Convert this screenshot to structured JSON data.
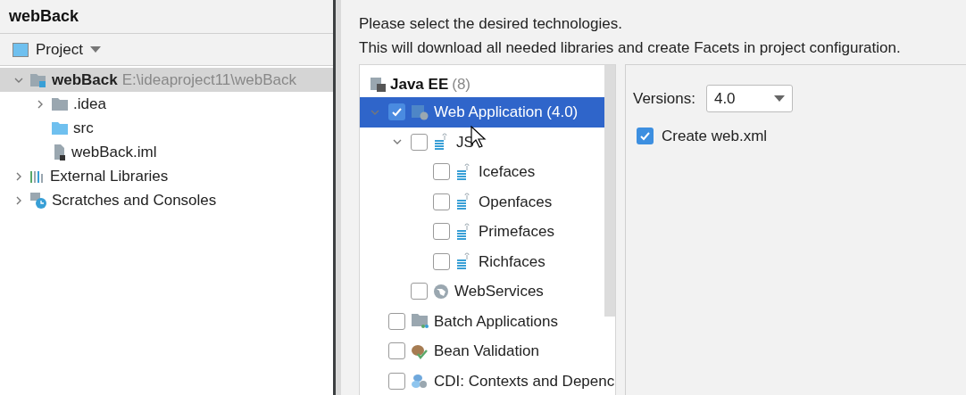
{
  "project_window": {
    "title": "webBack",
    "view_selector": "Project",
    "tree": [
      {
        "label": "webBack",
        "path": "E:\\ideaproject11\\webBack",
        "kind": "module",
        "selected": true,
        "expanded": true,
        "children": [
          {
            "label": ".idea",
            "kind": "folder",
            "expanded": false
          },
          {
            "label": "src",
            "kind": "source"
          },
          {
            "label": "webBack.iml",
            "kind": "file"
          }
        ]
      },
      {
        "label": "External Libraries",
        "kind": "libraries",
        "selected": false,
        "expanded": false
      },
      {
        "label": "Scratches and Consoles",
        "kind": "scratches",
        "selected": false,
        "expanded": false
      }
    ]
  },
  "dialog": {
    "instructions": [
      "Please select the desired technologies.",
      "This will download all needed libraries and create Facets in project configuration."
    ],
    "group": {
      "label": "Java EE",
      "count": "(8)"
    },
    "frameworks": [
      {
        "label": "Web Application (4.0)",
        "kind": "web",
        "checked": true,
        "selected": true,
        "expanded": true,
        "children": [
          {
            "label": "JS",
            "kind": "jsf",
            "checked": false,
            "selected": false,
            "expanded": true,
            "children": [
              {
                "label": "Icefaces",
                "kind": "jsf",
                "checked": false,
                "selected": false
              },
              {
                "label": "Openfaces",
                "kind": "jsf",
                "checked": false,
                "selected": false
              },
              {
                "label": "Primefaces",
                "kind": "jsf",
                "checked": false,
                "selected": false
              },
              {
                "label": "Richfaces",
                "kind": "jsf",
                "checked": false,
                "selected": false
              }
            ]
          },
          {
            "label": "WebServices",
            "kind": "globe",
            "checked": false,
            "selected": false
          }
        ]
      },
      {
        "label": "Batch Applications",
        "kind": "batch",
        "checked": false,
        "selected": false
      },
      {
        "label": "Bean Validation",
        "kind": "bean",
        "checked": false,
        "selected": false
      },
      {
        "label": "CDI: Contexts and Depenc",
        "kind": "cdi",
        "checked": false,
        "selected": false
      }
    ],
    "settings": {
      "versions_label": "Versions:",
      "version": "4.0",
      "create_web_xml": {
        "label": "Create web.xml",
        "checked": true
      }
    }
  }
}
